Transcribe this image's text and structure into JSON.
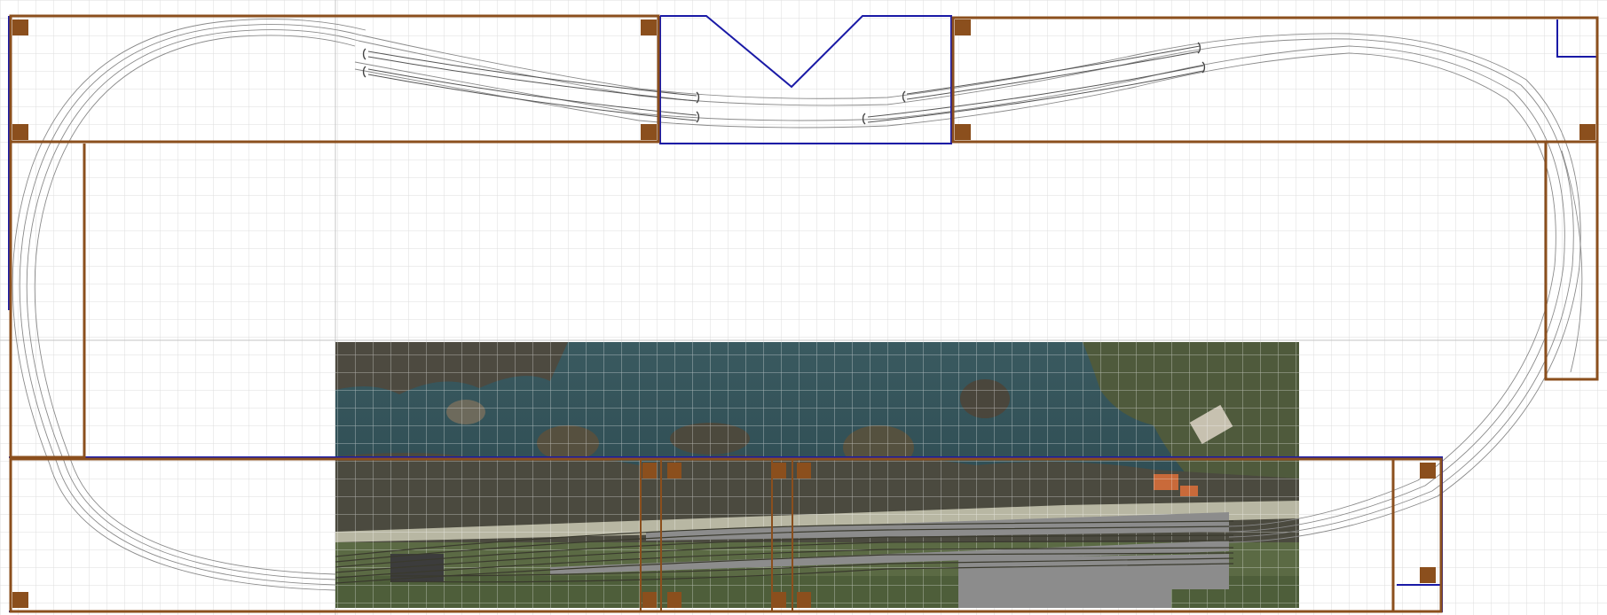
{
  "diagram": {
    "title": "",
    "subtitle": "",
    "kind": "model railway track plan",
    "background": "#ffffff",
    "grid": {
      "enabled": true,
      "minor_color": "#d9d9d9",
      "major_color": "#bfbfbf"
    },
    "colors": {
      "benchwork": "#8b4f1d",
      "benchwork_dark": "#6e3a12",
      "outline_blue": "#1a1aa6",
      "track_rail": "#8a8a8a",
      "platform": "#8c8c8c",
      "photo_sea": "#2e4f58",
      "photo_rock": "#4a4a40",
      "photo_land": "#5d6b45",
      "photo_road": "#b9b9a6"
    },
    "icons": [
      "turnout-icon",
      "benchwork-post-icon"
    ],
    "elements": [
      "upper-left-module",
      "upper-right-module",
      "v-notch-module",
      "left-return-module",
      "right-return-module",
      "lower-station-module",
      "aerial-photo-overlay",
      "station-track-fan",
      "station-platforms",
      "loop-track-oval"
    ]
  }
}
